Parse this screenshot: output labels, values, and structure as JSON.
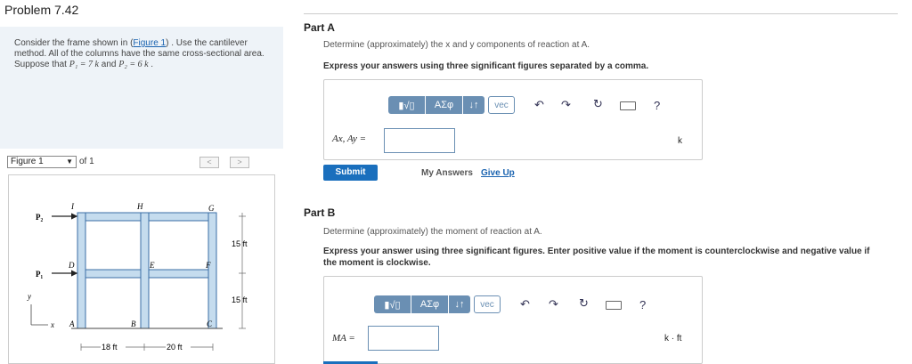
{
  "header": {
    "title": "Problem 7.42"
  },
  "problem": {
    "text_1": "Consider the frame shown in (",
    "figure_link": "Figure 1",
    "text_2": ") . Use the cantilever method. All of the columns have the same cross-sectional area. Suppose that ",
    "p1": "P₁ = 7  k",
    "and": " and ",
    "p2": "P₂ = 6  k",
    "end": " ."
  },
  "figure_nav": {
    "selected": "Figure 1",
    "of_label": "of 1",
    "prev": "<",
    "next": ">"
  },
  "figure": {
    "labels": {
      "P2": "P₂",
      "P1": "P₁",
      "I": "I",
      "H": "H",
      "G": "G",
      "D": "D",
      "E": "E",
      "F": "F",
      "A": "A",
      "B": "B",
      "C": "C",
      "y": "y",
      "x": "x"
    },
    "dims": {
      "upper": "15 ft",
      "lower": "15 ft",
      "left": "18 ft",
      "right": "20 ft"
    },
    "colors": {
      "member_fill": "#c5dcee",
      "member_stroke": "#3a6ea5"
    }
  },
  "part_a": {
    "title": "Part A",
    "question": "Determine (approximately) the x and y components of reaction at A.",
    "instruction": "Express your answers using three significant figures separated by a comma.",
    "answer_label": "Ax, Ay =",
    "unit": "k",
    "submit": "Submit",
    "my_answers": "My Answers",
    "give_up": "Give Up"
  },
  "part_b": {
    "title": "Part B",
    "question": "Determine (approximately) the moment of reaction at A.",
    "instruction": "Express your answer using three significant figures. Enter positive value if the moment is counterclockwise and negative value if the moment is clockwise.",
    "answer_label": "MA =",
    "unit": "k · ft"
  },
  "toolbar": {
    "templates": "▮√▯",
    "greek": "ΑΣφ",
    "arrows": "↓↑",
    "vec": "vec",
    "help": "?"
  }
}
